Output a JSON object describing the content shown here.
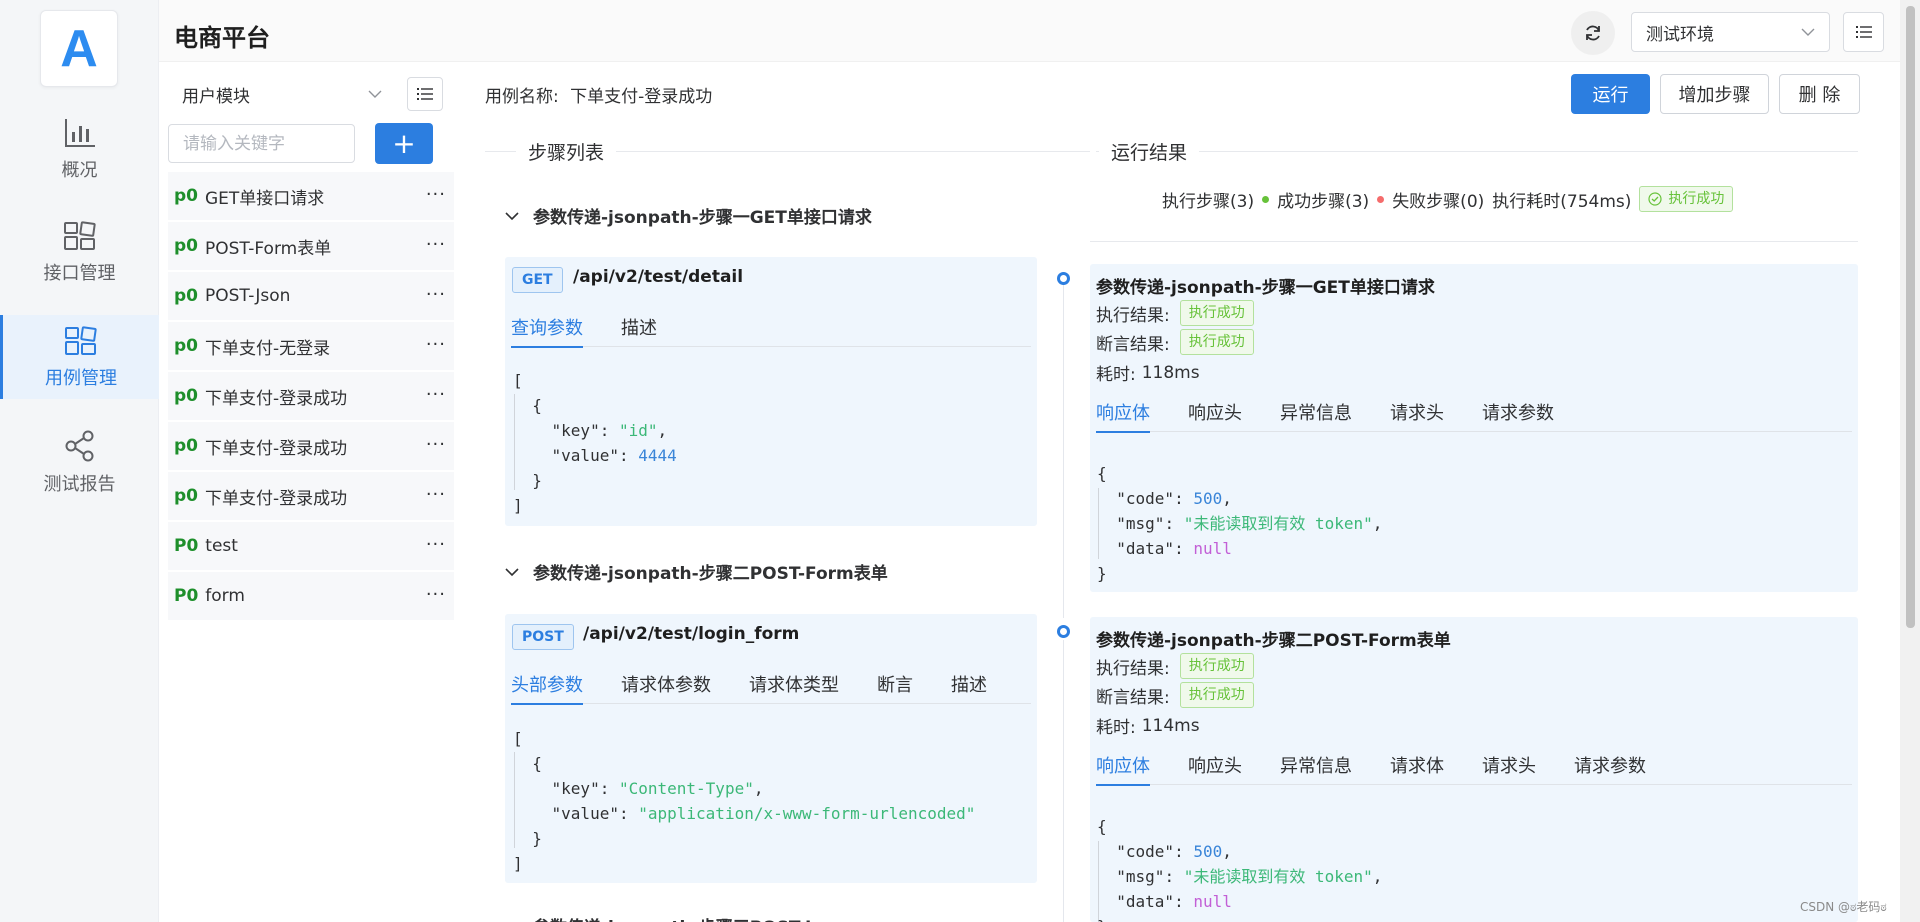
{
  "app": {
    "title": "电商平台",
    "logo_letter": "A"
  },
  "nav": {
    "items": [
      {
        "label": "概况",
        "icon": "bar-chart-icon"
      },
      {
        "label": "接口管理",
        "icon": "grid-icon"
      },
      {
        "label": "用例管理",
        "icon": "grid-icon",
        "active": true
      },
      {
        "label": "测试报告",
        "icon": "share-icon"
      }
    ]
  },
  "header": {
    "env_select": "测试环境"
  },
  "cases": {
    "module_select": "用户模块",
    "search_placeholder": "请输入关键字",
    "add_label": "+",
    "more_label": "···",
    "items": [
      {
        "priority": "p0",
        "name": "GET单接口请求"
      },
      {
        "priority": "p0",
        "name": "POST-Form表单"
      },
      {
        "priority": "p0",
        "name": "POST-Json"
      },
      {
        "priority": "p0",
        "name": "下单支付-无登录"
      },
      {
        "priority": "p0",
        "name": "下单支付-登录成功"
      },
      {
        "priority": "p0",
        "name": "下单支付-登录成功"
      },
      {
        "priority": "p0",
        "name": "下单支付-登录成功"
      },
      {
        "priority": "P0",
        "name": "test"
      },
      {
        "priority": "P0",
        "name": "form"
      }
    ]
  },
  "main": {
    "case_name_label": "用例名称:",
    "case_name": "下单支付-登录成功",
    "run_label": "运行",
    "add_step_label": "增加步骤",
    "delete_label": "删 除",
    "steps_title": "步骤列表",
    "results_title": "运行结果"
  },
  "steps": [
    {
      "title": "参数传递-jsonpath-步骤一GET单接口请求",
      "method": "GET",
      "path": "/api/v2/test/detail",
      "tabs": [
        "查询参数",
        "描述"
      ],
      "active_tab": "查询参数",
      "params": [
        {
          "key": "id",
          "value": 4444
        }
      ]
    },
    {
      "title": "参数传递-jsonpath-步骤二POST-Form表单",
      "method": "POST",
      "path": "/api/v2/test/login_form",
      "tabs": [
        "头部参数",
        "请求体参数",
        "请求体类型",
        "断言",
        "描述"
      ],
      "active_tab": "头部参数",
      "params": [
        {
          "key": "Content-Type",
          "value": "application/x-www-form-urlencoded"
        }
      ]
    },
    {
      "title": "参数传递-jsonpath-步骤三POST-Json"
    }
  ],
  "summary": {
    "executed": "执行步骤(3)",
    "success": "成功步骤(3)",
    "failed": "失败步骤(0)",
    "duration": "执行耗时(754ms)",
    "status": "执行成功",
    "success_color": "#67c23a",
    "fail_color": "#f56c6c"
  },
  "results": [
    {
      "title": "参数传递-jsonpath-步骤一GET单接口请求",
      "exec_label": "执行结果:",
      "exec_status": "执行成功",
      "assert_label": "断言结果:",
      "assert_status": "执行成功",
      "time_label": "耗时:",
      "time": "118ms",
      "tabs": [
        "响应体",
        "响应头",
        "异常信息",
        "请求头",
        "请求参数"
      ],
      "active_tab": "响应体",
      "body": {
        "code": 500,
        "msg": "未能读取到有效 token",
        "data": "null"
      }
    },
    {
      "title": "参数传递-jsonpath-步骤二POST-Form表单",
      "exec_label": "执行结果:",
      "exec_status": "执行成功",
      "assert_label": "断言结果:",
      "assert_status": "执行成功",
      "time_label": "耗时:",
      "time": "114ms",
      "tabs": [
        "响应体",
        "响应头",
        "异常信息",
        "请求体",
        "请求头",
        "请求参数"
      ],
      "active_tab": "响应体",
      "body": {
        "code": 500,
        "msg": "未能读取到有效 token",
        "data": "null"
      }
    }
  ],
  "watermark": "CSDN @ಠ老码ಠ"
}
